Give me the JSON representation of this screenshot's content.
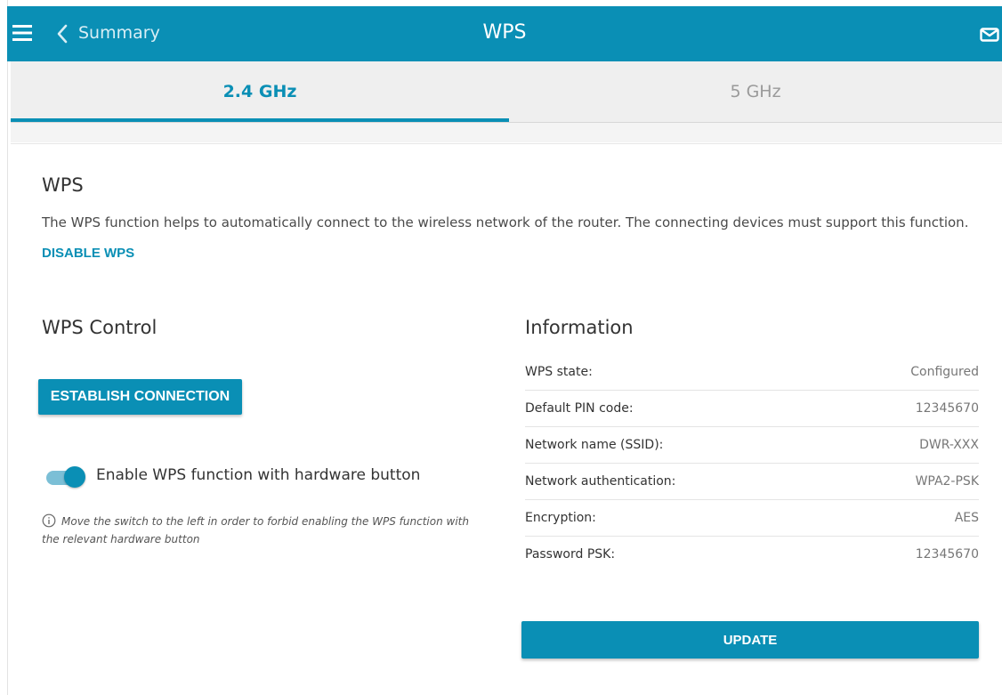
{
  "header": {
    "back_label": "Summary",
    "title": "WPS",
    "menu_icon": "hamburger-menu-icon",
    "back_icon": "chevron-left-icon",
    "mail_icon": "envelope-icon"
  },
  "tabs": [
    {
      "label": "2.4 GHz",
      "active": true
    },
    {
      "label": "5 GHz",
      "active": false
    }
  ],
  "wps": {
    "title": "WPS",
    "description": "The WPS function helps to automatically connect to the wireless network of the router. The connecting devices must support this function.",
    "disable_label": "DISABLE WPS"
  },
  "control": {
    "title": "WPS Control",
    "establish_label": "ESTABLISH CONNECTION",
    "toggle_label": "Enable WPS function with hardware button",
    "toggle_on": true,
    "hint_icon": "info-circle-icon",
    "hint": "Move the switch to the left in order to forbid enabling the WPS function with the relevant hardware button"
  },
  "information": {
    "title": "Information",
    "rows": [
      {
        "key": "WPS state:",
        "value": "Configured"
      },
      {
        "key": "Default PIN code:",
        "value": "12345670"
      },
      {
        "key": "Network name (SSID):",
        "value": "DWR-XXX"
      },
      {
        "key": "Network authentication:",
        "value": "WPA2-PSK"
      },
      {
        "key": "Encryption:",
        "value": "AES"
      },
      {
        "key": "Password PSK:",
        "value": "12345670"
      }
    ],
    "update_label": "UPDATE"
  },
  "colors": {
    "accent": "#0a8fb5",
    "header_bg": "#0a8fb5",
    "tab_bar_bg": "#efefef"
  }
}
